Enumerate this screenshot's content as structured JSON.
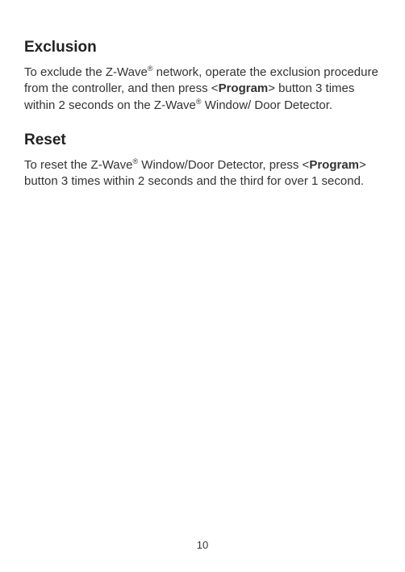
{
  "sections": [
    {
      "heading": "Exclusion",
      "para_parts": [
        {
          "t": "To exclude the Z-Wave"
        },
        {
          "t": "®",
          "sup": true
        },
        {
          "t": " network, operate the exclusion procedure from the controller, and then press <"
        },
        {
          "t": "Program",
          "bold": true
        },
        {
          "t": "> button 3 times within 2 seconds on the Z-Wave"
        },
        {
          "t": "®",
          "sup": true
        },
        {
          "t": " Window/ Door Detector."
        }
      ]
    },
    {
      "heading": "Reset",
      "para_parts": [
        {
          "t": "To reset the Z-Wave"
        },
        {
          "t": "®",
          "sup": true
        },
        {
          "t": " Window/Door Detector, press <"
        },
        {
          "t": "Program",
          "bold": true
        },
        {
          "t": "> button 3 times within 2 seconds and the third for over 1 second."
        }
      ]
    }
  ],
  "page_number": "10"
}
